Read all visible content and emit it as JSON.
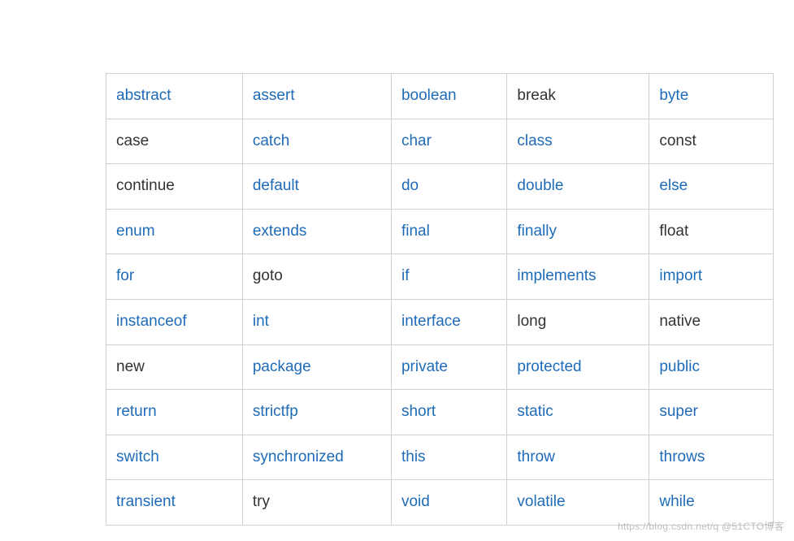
{
  "rows": [
    [
      {
        "text": "abstract",
        "link": true
      },
      {
        "text": "assert",
        "link": true
      },
      {
        "text": "boolean",
        "link": true
      },
      {
        "text": "break",
        "link": false
      },
      {
        "text": "byte",
        "link": true
      }
    ],
    [
      {
        "text": "case",
        "link": false
      },
      {
        "text": "catch",
        "link": true
      },
      {
        "text": "char",
        "link": true
      },
      {
        "text": "class",
        "link": true
      },
      {
        "text": "const",
        "link": false
      }
    ],
    [
      {
        "text": "continue",
        "link": false
      },
      {
        "text": "default",
        "link": true
      },
      {
        "text": "do",
        "link": true
      },
      {
        "text": "double",
        "link": true
      },
      {
        "text": "else",
        "link": true
      }
    ],
    [
      {
        "text": "enum",
        "link": true
      },
      {
        "text": "extends",
        "link": true
      },
      {
        "text": "final",
        "link": true
      },
      {
        "text": "finally",
        "link": true
      },
      {
        "text": "float",
        "link": false
      }
    ],
    [
      {
        "text": "for",
        "link": true
      },
      {
        "text": "goto",
        "link": false
      },
      {
        "text": "if",
        "link": true
      },
      {
        "text": "implements",
        "link": true
      },
      {
        "text": "import",
        "link": true
      }
    ],
    [
      {
        "text": "instanceof",
        "link": true
      },
      {
        "text": "int",
        "link": true
      },
      {
        "text": "interface",
        "link": true
      },
      {
        "text": "long",
        "link": false
      },
      {
        "text": "native",
        "link": false
      }
    ],
    [
      {
        "text": "new",
        "link": false
      },
      {
        "text": "package",
        "link": true
      },
      {
        "text": "private",
        "link": true
      },
      {
        "text": "protected",
        "link": true
      },
      {
        "text": "public",
        "link": true
      }
    ],
    [
      {
        "text": "return",
        "link": true
      },
      {
        "text": "strictfp",
        "link": true
      },
      {
        "text": "short",
        "link": true
      },
      {
        "text": "static",
        "link": true
      },
      {
        "text": "super",
        "link": true
      }
    ],
    [
      {
        "text": "switch",
        "link": true
      },
      {
        "text": "synchronized",
        "link": true
      },
      {
        "text": "this",
        "link": true
      },
      {
        "text": "throw",
        "link": true
      },
      {
        "text": "throws",
        "link": true
      }
    ],
    [
      {
        "text": "transient",
        "link": true
      },
      {
        "text": "try",
        "link": false
      },
      {
        "text": "void",
        "link": true
      },
      {
        "text": "volatile",
        "link": true
      },
      {
        "text": "while",
        "link": true
      }
    ]
  ],
  "watermark": "https://blog.csdn.net/q  @51CTO博客"
}
